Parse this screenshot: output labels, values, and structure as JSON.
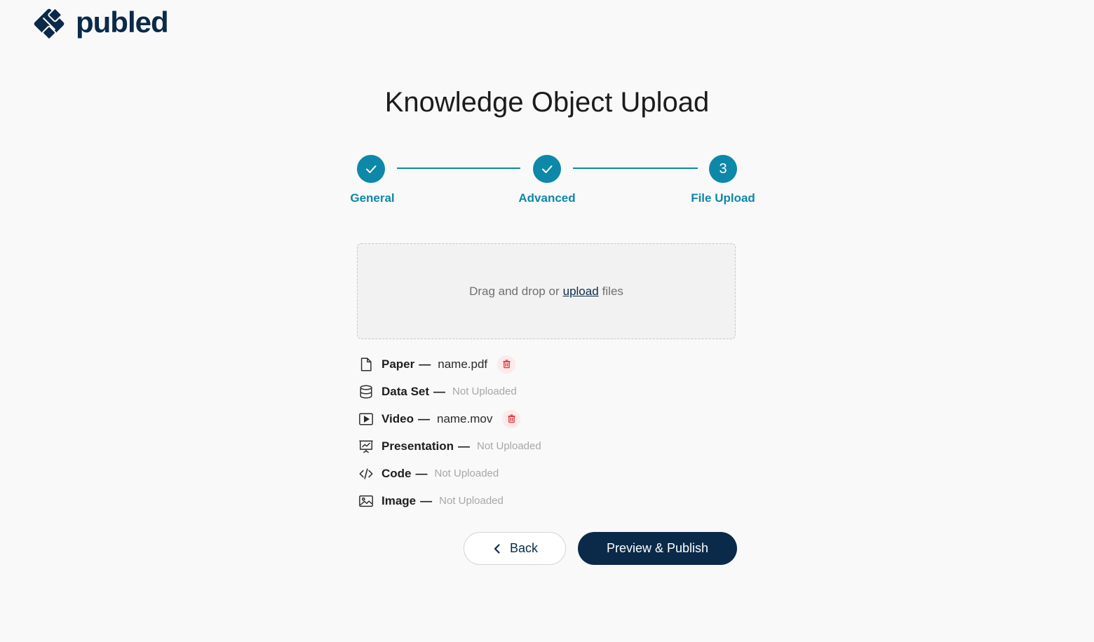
{
  "brand": {
    "name": "publed",
    "color": "#0b2a4a"
  },
  "page": {
    "title": "Knowledge Object Upload"
  },
  "stepper": {
    "accent": "#0d88a8",
    "steps": [
      {
        "label": "General",
        "state": "completed",
        "marker": "check-icon"
      },
      {
        "label": "Advanced",
        "state": "completed",
        "marker": "check-icon"
      },
      {
        "label": "File Upload",
        "state": "current",
        "marker": "3"
      }
    ]
  },
  "dropzone": {
    "text_before": "Drag and drop or",
    "link_text": "upload",
    "text_after": "files"
  },
  "files": [
    {
      "type": "Paper",
      "icon": "document-icon",
      "value": "name.pdf",
      "uploaded": true
    },
    {
      "type": "Data Set",
      "icon": "database-icon",
      "value": "Not Uploaded",
      "uploaded": false
    },
    {
      "type": "Video",
      "icon": "video-icon",
      "value": "name.mov",
      "uploaded": true
    },
    {
      "type": "Presentation",
      "icon": "presentation-icon",
      "value": "Not Uploaded",
      "uploaded": false
    },
    {
      "type": "Code",
      "icon": "code-icon",
      "value": "Not Uploaded",
      "uploaded": false
    },
    {
      "type": "Image",
      "icon": "image-icon",
      "value": "Not Uploaded",
      "uploaded": false
    }
  ],
  "separator": "—",
  "actions": {
    "back_label": "Back",
    "publish_label": "Preview & Publish"
  },
  "colors": {
    "delete": "#e03b3b",
    "muted": "#a7a7a7"
  }
}
